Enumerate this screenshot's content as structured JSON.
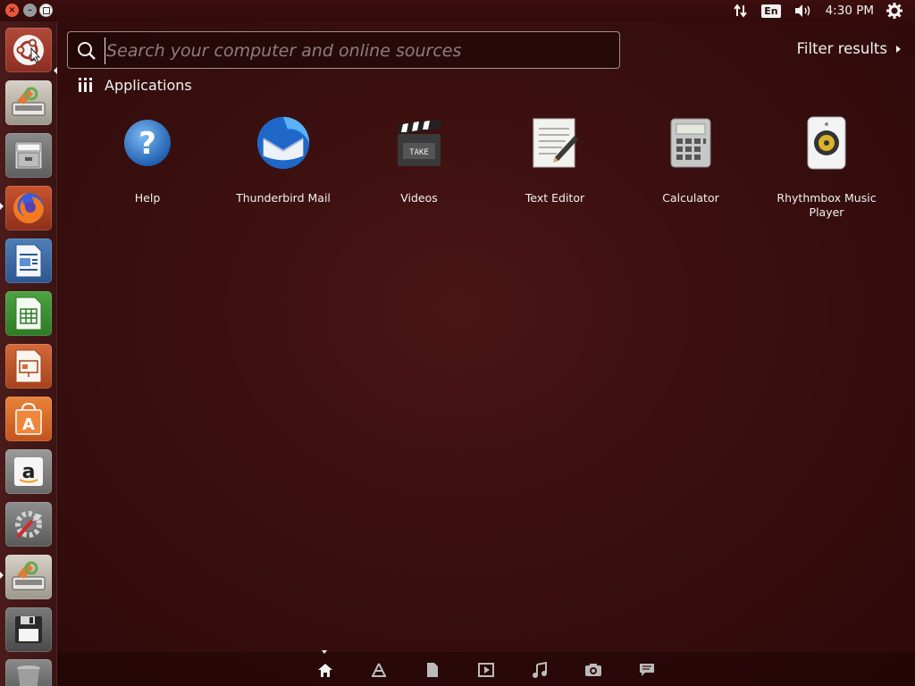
{
  "top_panel": {
    "window_buttons": {
      "close": "×",
      "minimize": "–"
    },
    "indicators": {
      "network_icon": "network-arrows-icon",
      "language": "En",
      "volume_icon": "speaker-icon",
      "clock": "4:30 PM",
      "session_icon": "gear-icon"
    }
  },
  "launcher": {
    "items": [
      {
        "name": "dash-home",
        "icon": "ubuntu-logo-icon"
      },
      {
        "name": "install-ubuntu",
        "icon": "installer-icon"
      },
      {
        "name": "files",
        "icon": "file-cabinet-icon"
      },
      {
        "name": "firefox",
        "icon": "firefox-icon"
      },
      {
        "name": "libreoffice-writer",
        "icon": "writer-icon"
      },
      {
        "name": "libreoffice-calc",
        "icon": "calc-icon"
      },
      {
        "name": "libreoffice-impress",
        "icon": "impress-icon"
      },
      {
        "name": "ubuntu-software",
        "icon": "software-bag-icon"
      },
      {
        "name": "amazon",
        "icon": "amazon-icon"
      },
      {
        "name": "system-settings",
        "icon": "settings-wrench-icon"
      },
      {
        "name": "install-ubuntu-2",
        "icon": "installer-icon"
      },
      {
        "name": "floppy",
        "icon": "floppy-disk-icon"
      },
      {
        "name": "trash",
        "icon": "trash-icon"
      }
    ]
  },
  "search": {
    "value": "",
    "placeholder": "Search your computer and online sources"
  },
  "filter": {
    "label": "Filter results"
  },
  "category": {
    "label": "Applications"
  },
  "apps": [
    {
      "label": "Help",
      "icon": "help-icon"
    },
    {
      "label": "Thunderbird Mail",
      "icon": "thunderbird-icon"
    },
    {
      "label": "Videos",
      "icon": "clapperboard-icon"
    },
    {
      "label": "Text Editor",
      "icon": "text-editor-icon"
    },
    {
      "label": "Calculator",
      "icon": "calculator-icon"
    },
    {
      "label": "Rhythmbox Music Player",
      "icon": "speaker-icon"
    }
  ],
  "lenses": [
    {
      "name": "home",
      "icon": "home-icon"
    },
    {
      "name": "applications",
      "icon": "applications-lens-icon"
    },
    {
      "name": "files",
      "icon": "file-lens-icon"
    },
    {
      "name": "videos",
      "icon": "video-lens-icon"
    },
    {
      "name": "music",
      "icon": "music-note-icon"
    },
    {
      "name": "photos",
      "icon": "camera-icon"
    },
    {
      "name": "social",
      "icon": "chat-bubble-icon"
    }
  ],
  "colors": {
    "background": "#3a0f0f",
    "panel": "#320b0b",
    "close_button": "#e9573f"
  }
}
